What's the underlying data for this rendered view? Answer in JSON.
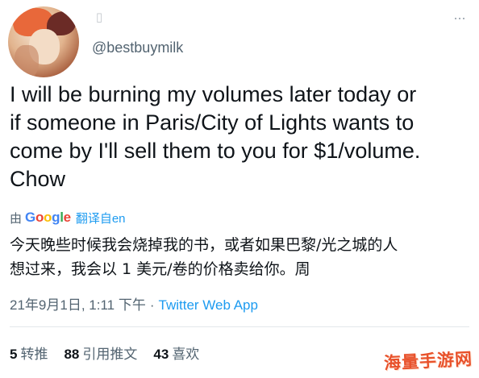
{
  "author": {
    "handle": "@bestbuymilk",
    "verified_glyph": "▯"
  },
  "more_icon": "...",
  "tweet": {
    "text_lines": [
      "I will be burning my volumes later today or",
      "if someone in Paris/City of Lights wants to",
      "come by I'll sell them to you for $1/volume.",
      "Chow"
    ]
  },
  "translation": {
    "prefix": "由",
    "provider": [
      "G",
      "o",
      "o",
      "g",
      "l",
      "e"
    ],
    "link_label": "翻译自en",
    "text_lines": [
      "今天晚些时候我会烧掉我的书，或者如果巴黎/光之城的人",
      "想过来，我会以 1 美元/卷的价格卖给你。周"
    ]
  },
  "meta": {
    "timestamp": "21年9月1日, 1:11 下午",
    "separator": "·",
    "source": "Twitter Web App"
  },
  "stats": [
    {
      "count": "5",
      "label": "转推"
    },
    {
      "count": "88",
      "label": "引用推文"
    },
    {
      "count": "43",
      "label": "喜欢"
    }
  ],
  "watermark": "海量手游网",
  "colors": {
    "link": "#1d9bf0",
    "secondary_text": "#536471",
    "watermark": "#e8512a"
  }
}
